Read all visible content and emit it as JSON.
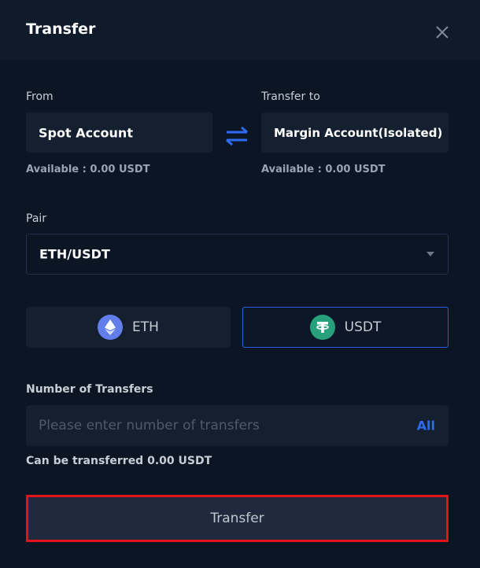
{
  "header": {
    "title": "Transfer",
    "close_icon": "close-icon"
  },
  "from": {
    "label": "From",
    "account": "Spot Account",
    "available": "Available : 0.00 USDT"
  },
  "swap": {
    "icon": "swap-arrows-icon",
    "color": "#2e6bf3"
  },
  "to": {
    "label": "Transfer to",
    "account": "Margin Account(Isolated)",
    "available": "Available : 0.00 USDT"
  },
  "pair": {
    "label": "Pair",
    "selected": "ETH/USDT"
  },
  "coins": {
    "eth": {
      "label": "ETH",
      "icon": "ethereum-icon",
      "color": "#627eea"
    },
    "usdt": {
      "label": "USDT",
      "icon": "tether-icon",
      "color": "#26a17b",
      "selected": true
    }
  },
  "amount": {
    "label": "Number of Transfers",
    "placeholder": "Please enter number of transfers",
    "value": "",
    "all_label": "All"
  },
  "can_transfer": "Can be transferred 0.00 USDT",
  "submit": {
    "label": "Transfer",
    "highlight_color": "#e3131b"
  }
}
